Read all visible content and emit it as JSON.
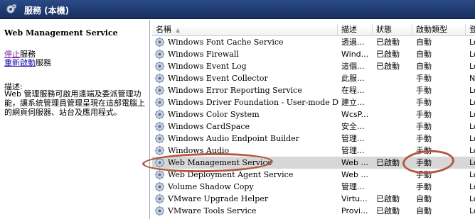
{
  "window": {
    "title": "服務 (本機)",
    "icon": "gear-icon"
  },
  "left_pane": {
    "service_title": "Web Management Service",
    "actions": [
      {
        "link": "停止",
        "suffix": "服務"
      },
      {
        "link": "重新啟動",
        "suffix": "服務"
      }
    ],
    "description_label": "描述:",
    "description": "Web 管理服務可啟用遠端及委派管理功能，讓系統管理員管理呈現在這部電腦上的網頁伺服器、站台及應用程式。"
  },
  "columns": [
    "名稱",
    "描述",
    "狀態",
    "啟動類型",
    "登"
  ],
  "services": [
    {
      "name": "Windows Font Cache Service",
      "desc": "透過...",
      "status": "已啟動",
      "startup": "自動",
      "logon": "Lo"
    },
    {
      "name": "Windows Firewall",
      "desc": "Wind...",
      "status": "已啟動",
      "startup": "自動",
      "logon": "Lo"
    },
    {
      "name": "Windows Event Log",
      "desc": "這個...",
      "status": "已啟動",
      "startup": "自動",
      "logon": "Lo"
    },
    {
      "name": "Windows Event Collector",
      "desc": "此服...",
      "status": "",
      "startup": "手動",
      "logon": "Ne"
    },
    {
      "name": "Windows Error Reporting Service",
      "desc": "在程...",
      "status": "",
      "startup": "手動",
      "logon": "Lo"
    },
    {
      "name": "Windows Driver Foundation - User-mode Driver...",
      "desc": "建立...",
      "status": "",
      "startup": "手動",
      "logon": "Lo"
    },
    {
      "name": "Windows Color System",
      "desc": "WcsP...",
      "status": "",
      "startup": "手動",
      "logon": "Lo"
    },
    {
      "name": "Windows CardSpace",
      "desc": "安全...",
      "status": "",
      "startup": "手動",
      "logon": "Lo"
    },
    {
      "name": "Windows Audio Endpoint Builder",
      "desc": "管理...",
      "status": "",
      "startup": "手動",
      "logon": "Lo"
    },
    {
      "name": "Windows Audio",
      "desc": "管理...",
      "status": "",
      "startup": "手動",
      "logon": "Lo"
    },
    {
      "name": "Web Management Service",
      "desc": "Web ...",
      "status": "已啟動",
      "startup": "手動",
      "logon": "Lo",
      "selected": true
    },
    {
      "name": "Web Deployment Agent Service",
      "desc": "Web ...",
      "status": "",
      "startup": "手動",
      "logon": "Lo"
    },
    {
      "name": "Volume Shadow Copy",
      "desc": "管理...",
      "status": "",
      "startup": "手動",
      "logon": "Lo"
    },
    {
      "name": "VMware Upgrade Helper",
      "desc": "Virtu...",
      "status": "已啟動",
      "startup": "自動",
      "logon": "Lo"
    },
    {
      "name": "VMware Tools Service",
      "desc": "Provi...",
      "status": "已啟動",
      "startup": "自動",
      "logon": "Lo"
    }
  ],
  "annotation_color": "#b15a3f"
}
